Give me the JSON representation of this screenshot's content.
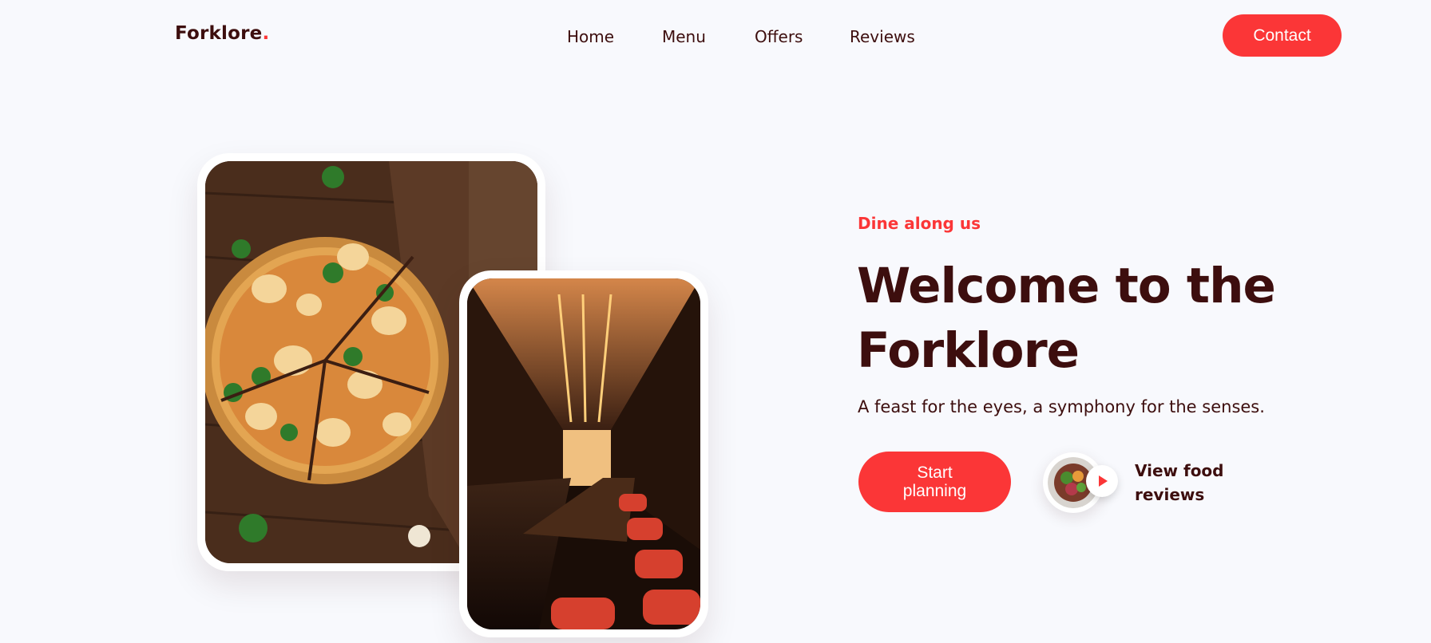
{
  "brand": {
    "name": "Forklore",
    "dot": "."
  },
  "nav": {
    "items": [
      {
        "label": "Home"
      },
      {
        "label": "Menu"
      },
      {
        "label": "Offers"
      },
      {
        "label": "Reviews"
      }
    ],
    "contact_label": "Contact"
  },
  "hero": {
    "eyebrow": "Dine along us",
    "headline": "Welcome to the Forklore",
    "subtext": "A feast for the eyes, a symphony for the senses.",
    "primary_cta": "Start planning",
    "video_label": "View food reviews",
    "video_icon": "play-icon"
  },
  "images": {
    "card_1": "pizza-photo",
    "card_2": "restaurant-interior-photo",
    "thumb": "salad-bowl-photo"
  },
  "colors": {
    "accent": "#fb3637",
    "text": "#3d0e0e",
    "background": "#f8f9fd"
  }
}
